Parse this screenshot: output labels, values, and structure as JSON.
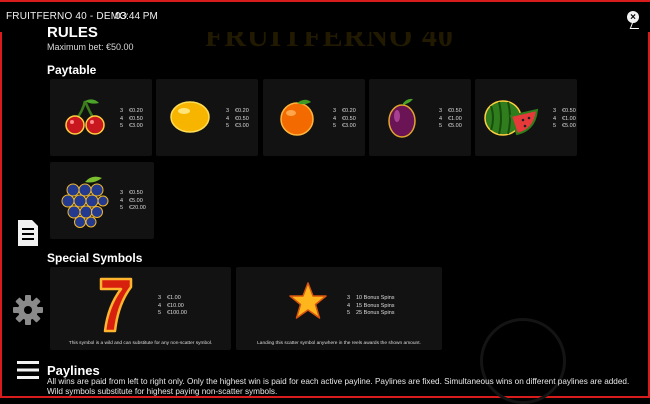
{
  "topbar": {
    "game_title": "FRUITFERNO 40 - DEMO",
    "clock": "03:44 PM",
    "close_symbol": "×",
    "background_logo": "FRUITFERNO 40"
  },
  "rules": {
    "title": "RULES",
    "max_bet": "Maximum bet: €50.00"
  },
  "paytable": {
    "title": "Paytable",
    "symbols": [
      {
        "name": "cherry-icon",
        "pays": [
          [
            "3",
            "€0.20"
          ],
          [
            "4",
            "€0.50"
          ],
          [
            "5",
            "€3.00"
          ]
        ]
      },
      {
        "name": "lemon-icon",
        "pays": [
          [
            "3",
            "€0.20"
          ],
          [
            "4",
            "€0.50"
          ],
          [
            "5",
            "€3.00"
          ]
        ]
      },
      {
        "name": "orange-icon",
        "pays": [
          [
            "3",
            "€0.20"
          ],
          [
            "4",
            "€0.50"
          ],
          [
            "5",
            "€3.00"
          ]
        ]
      },
      {
        "name": "plum-icon",
        "pays": [
          [
            "3",
            "€0.50"
          ],
          [
            "4",
            "€1.00"
          ],
          [
            "5",
            "€5.00"
          ]
        ]
      },
      {
        "name": "watermelon-icon",
        "pays": [
          [
            "3",
            "€0.50"
          ],
          [
            "4",
            "€1.00"
          ],
          [
            "5",
            "€5.00"
          ]
        ]
      },
      {
        "name": "grapes-icon",
        "pays": [
          [
            "3",
            "€0.50"
          ],
          [
            "4",
            "€5.00"
          ],
          [
            "5",
            "€20.00"
          ]
        ]
      }
    ]
  },
  "special": {
    "title": "Special Symbols",
    "wild": {
      "pays": [
        [
          "3",
          "€1.00"
        ],
        [
          "4",
          "€10.00"
        ],
        [
          "5",
          "€100.00"
        ]
      ],
      "description": "This symbol is a wild and can substitute for any non-scatter symbol."
    },
    "scatter": {
      "pays": [
        [
          "3",
          "10 Bonus Spins"
        ],
        [
          "4",
          "15 Bonus Spins"
        ],
        [
          "5",
          "25 Bonus Spins"
        ]
      ],
      "description": "Landing this scatter symbol anywhere in the reels awards the shown amount."
    }
  },
  "paylines": {
    "title": "Paylines",
    "text": "All wins are paid from left to right only. Only the highest win is paid for each active payline. Paylines are fixed. Simultaneous wins on different paylines are added. Wild symbols substitute for highest paying non-scatter symbols."
  },
  "sidebar": {
    "icons": [
      "document-icon",
      "gear-icon",
      "menu-icon"
    ]
  },
  "colors": {
    "accent": "#d81b1b",
    "card": "#121212"
  }
}
